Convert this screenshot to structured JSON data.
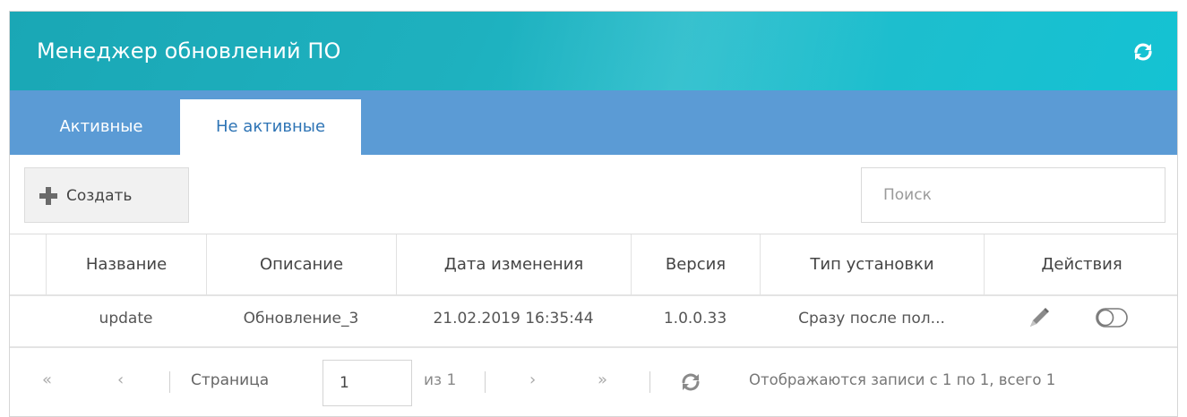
{
  "header": {
    "title": "Менеджер обновлений ПО",
    "refresh_icon": "refresh-icon"
  },
  "tabs": [
    {
      "label": "Активные",
      "selected": false
    },
    {
      "label": "Не активные",
      "selected": true
    }
  ],
  "toolbar": {
    "create_label": "Создать",
    "create_icon": "plus-icon",
    "search_placeholder": "Поиск",
    "search_value": ""
  },
  "table": {
    "columns": [
      "Название",
      "Описание",
      "Дата изменения",
      "Версия",
      "Тип установки",
      "Действия"
    ],
    "rows": [
      {
        "name": "update",
        "description": "Обновление_3",
        "modified": "21.02.2019 16:35:44",
        "version": "1.0.0.33",
        "install_type": "Сразу после пол...",
        "actions": [
          "pencil-icon",
          "toggle-icon"
        ]
      }
    ]
  },
  "pager": {
    "page_label": "Страница",
    "page_value": "1",
    "of_label": "из 1",
    "status": "Отображаются записи с 1 по 1, всего 1"
  },
  "colors": {
    "header": "#1eb1bf",
    "tabs_bar": "#5b9bd5",
    "tab_text_active": "#2e74b5"
  }
}
